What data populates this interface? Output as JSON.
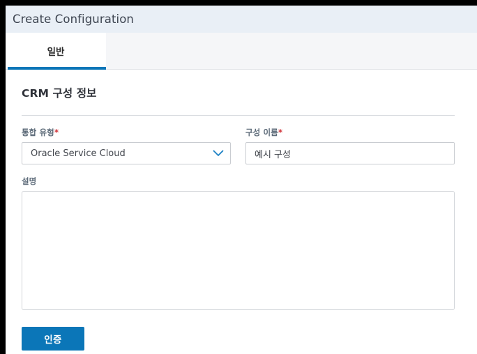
{
  "window": {
    "title": "Create Configuration"
  },
  "tabs": [
    {
      "label": "일반",
      "active": true
    }
  ],
  "section": {
    "title": "CRM 구성 정보"
  },
  "fields": {
    "integration_type": {
      "label": "통합 유형",
      "required_marker": "*",
      "value": "Oracle Service Cloud",
      "chevron_icon": "chevron-down-icon"
    },
    "configuration_name": {
      "label": "구성 이름",
      "required_marker": "*",
      "value": "예시 구성",
      "placeholder": ""
    },
    "description": {
      "label": "설명",
      "value": "",
      "placeholder": ""
    }
  },
  "actions": {
    "authenticate_label": "인증"
  },
  "colors": {
    "accent_blue": "#0b76b8",
    "title_bar_bg": "#e9eff6",
    "tab_strip_bg": "#f5f6f8",
    "required_red": "#d0343a",
    "label_gray": "#5d6b79",
    "border_gray": "#c9ccd1"
  }
}
